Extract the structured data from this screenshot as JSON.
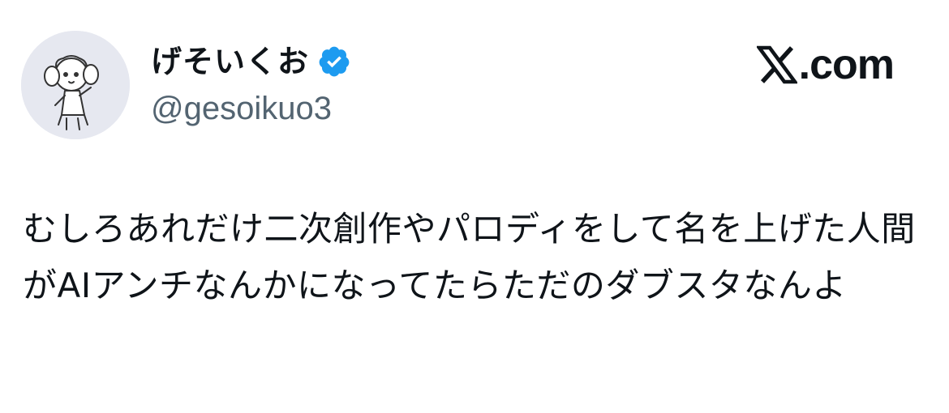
{
  "author": {
    "display_name": "げそいくお",
    "handle": "@gesoikuo3",
    "verified": true
  },
  "brand": {
    "text": ".com"
  },
  "post": {
    "text": "むしろあれだけ二次創作やパロディをして名を上げた人間がAIアンチなんかになってたらただのダブスタなんよ"
  },
  "colors": {
    "verified_badge": "#1d9bf0",
    "handle": "#536471",
    "text": "#0f1419",
    "avatar_bg": "#e6e8f0"
  },
  "icons": {
    "avatar": "avatar-illustration",
    "verified": "verified-badge-icon",
    "brand": "x-logo-icon"
  }
}
